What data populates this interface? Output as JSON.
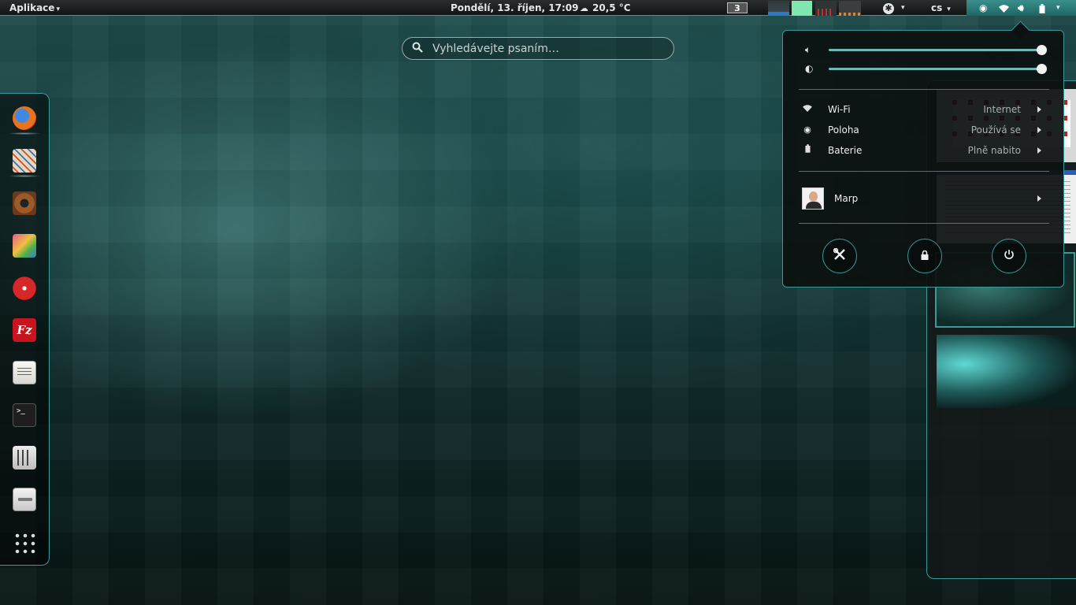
{
  "top_panel": {
    "apps_label": "Aplikace",
    "clock": "Pondělí, 13. říjen, 17:09",
    "weather": "20,5 °C",
    "workspace_number": "3",
    "language": "cs"
  },
  "search": {
    "placeholder": "Vyhledávejte psaním…"
  },
  "dash": {
    "apps": [
      "firefox",
      "mail",
      "rhythmbox",
      "gimp",
      "brasero",
      "filezilla",
      "text-editor",
      "terminal",
      "mixer",
      "files"
    ],
    "filezilla_glyph": "Fz",
    "terminal_glyph": ">_"
  },
  "system_menu": {
    "volume_level": 1.0,
    "brightness_level": 1.0,
    "rows": [
      {
        "label": "Wi-Fi",
        "status": "Internet",
        "icon": "wifi-icon"
      },
      {
        "label": "Poloha",
        "status": "Používá se",
        "icon": "location-icon"
      },
      {
        "label": "Baterie",
        "status": "Plně nabito",
        "icon": "battery-icon"
      }
    ],
    "user": {
      "name": "Marp"
    },
    "buttons": [
      "settings-icon",
      "lock-icon",
      "power-icon"
    ]
  },
  "colors": {
    "accent": "#3a9a98",
    "panel": "#111414"
  }
}
